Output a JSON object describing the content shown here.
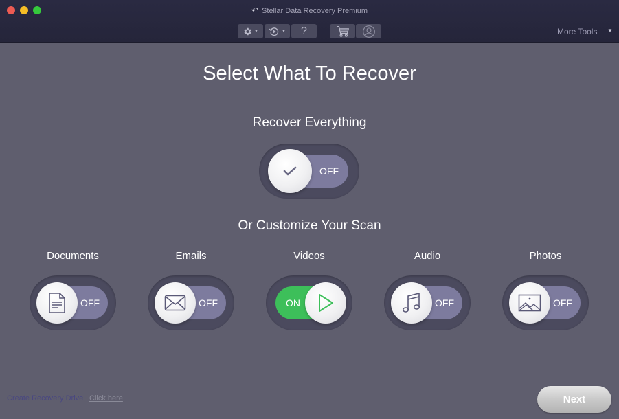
{
  "window": {
    "title": "Stellar Data Recovery Premium"
  },
  "toolbar": {
    "settings_icon": "gear-icon",
    "history_icon": "history-icon",
    "help_label": "?",
    "cart_icon": "cart-icon",
    "account_icon": "user-icon",
    "more_tools_label": "More Tools"
  },
  "main": {
    "title": "Select What To Recover",
    "recover_everything": {
      "label": "Recover Everything",
      "state": "OFF",
      "on": false
    },
    "customize_label": "Or Customize Your Scan",
    "categories": [
      {
        "label": "Documents",
        "state": "OFF",
        "on": false,
        "icon": "document-icon"
      },
      {
        "label": "Emails",
        "state": "OFF",
        "on": false,
        "icon": "envelope-icon"
      },
      {
        "label": "Videos",
        "state": "ON",
        "on": true,
        "icon": "play-icon"
      },
      {
        "label": "Audio",
        "state": "OFF",
        "on": false,
        "icon": "music-note-icon"
      },
      {
        "label": "Photos",
        "state": "OFF",
        "on": false,
        "icon": "image-icon"
      }
    ]
  },
  "footer": {
    "create_recovery_drive": "Create Recovery Drive",
    "click_here": "Click here",
    "next_label": "Next"
  },
  "colors": {
    "background": "#5f5e6e",
    "titlebar": "#27273c",
    "toggle_off_track": "#7d7b9e",
    "toggle_on_track": "#3dbf5a"
  }
}
